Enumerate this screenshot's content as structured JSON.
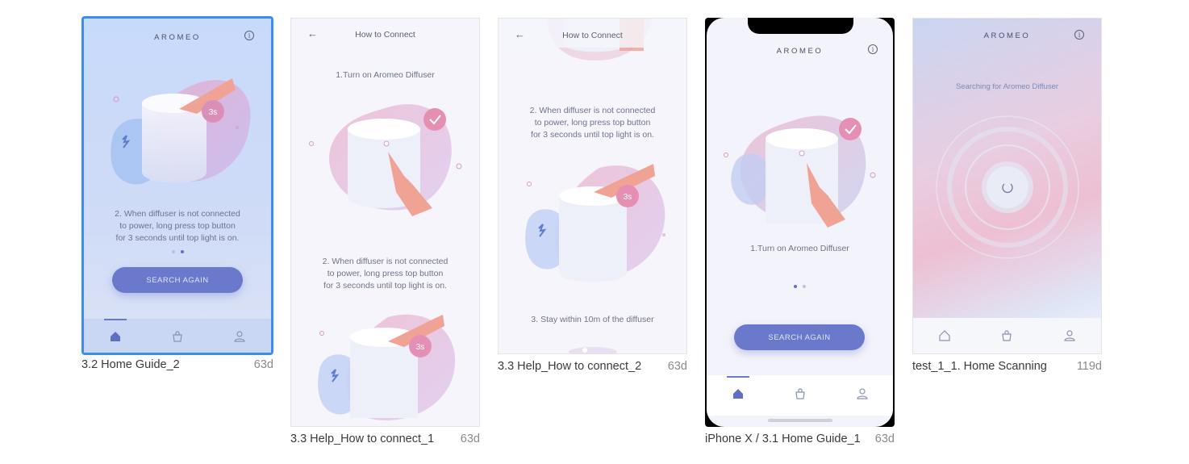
{
  "brand": "AROMEO",
  "cards": [
    {
      "caption": "3.2 Home Guide_2",
      "age": "63d"
    },
    {
      "caption": "3.3 Help_How to connect_1",
      "age": "63d"
    },
    {
      "caption": "3.3 Help_How to connect_2",
      "age": "63d"
    },
    {
      "caption": "iPhone X / 3.1 Home Guide_1",
      "age": "63d"
    },
    {
      "caption": "test_1_1. Home Scanning",
      "age": "119d"
    }
  ],
  "screens": {
    "guide2": {
      "step_text": "2. When diffuser is not connected\nto power, long press top button\nfor 3 seconds until top light is on.",
      "button": "SEARCH AGAIN",
      "timer": "3s"
    },
    "connect1": {
      "title": "How to Connect",
      "step1": "1.Turn on Aromeo Diffuser",
      "step2": "2. When diffuser is not connected\nto power, long press top button\nfor 3 seconds until top light is on.",
      "timer": "3s"
    },
    "connect2": {
      "title": "How to Connect",
      "step2": "2. When diffuser is not connected\nto power, long press top button\nfor 3 seconds until top light is on.",
      "step3": "3. Stay within 10m of the diffuser",
      "timer": "3s"
    },
    "guide1": {
      "step_text": "1.Turn on Aromeo Diffuser",
      "button": "SEARCH AGAIN"
    },
    "scanning": {
      "status": "Searching for Aromeo Diffuser"
    }
  },
  "icons": {
    "home": "home-icon",
    "shop": "shopping-bag-icon",
    "profile": "profile-icon",
    "info": "info-icon",
    "back": "back-arrow-icon"
  },
  "colors": {
    "selection": "#3b8ef0",
    "accent": "#6a79cc",
    "pink": "#e68fb4"
  }
}
